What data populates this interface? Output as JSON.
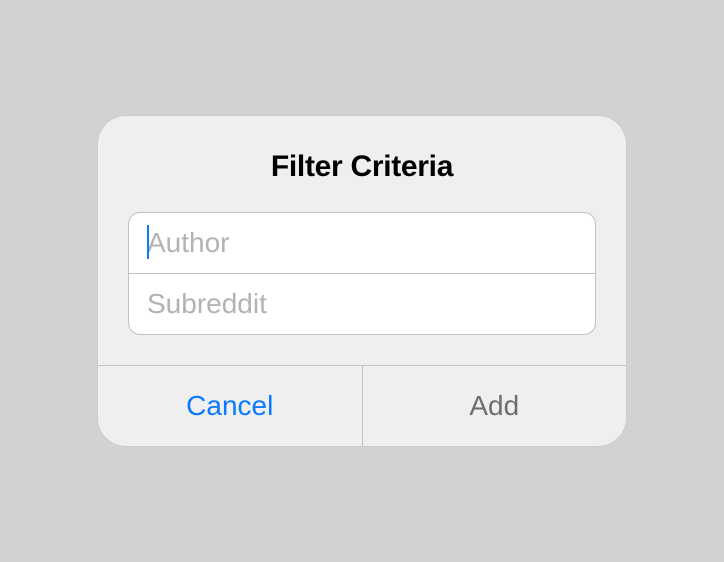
{
  "dialog": {
    "title": "Filter Criteria",
    "fields": {
      "author": {
        "placeholder": "Author",
        "value": ""
      },
      "subreddit": {
        "placeholder": "Subreddit",
        "value": ""
      }
    },
    "buttons": {
      "cancel": "Cancel",
      "add": "Add"
    }
  }
}
